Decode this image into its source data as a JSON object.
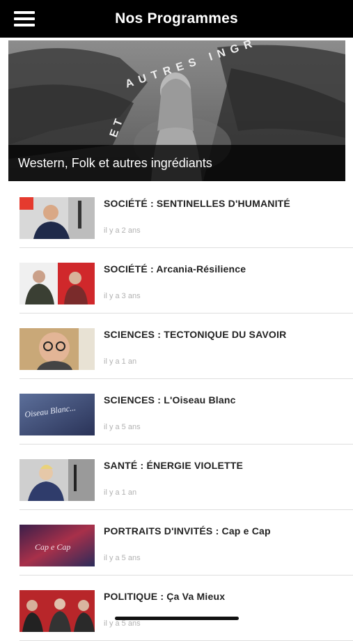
{
  "header": {
    "title": "Nos Programmes",
    "menu_icon": "hamburger-menu-icon"
  },
  "hero": {
    "caption": "Western, Folk et autres ingrédiants",
    "arc_text": "AUTRES INGR",
    "arc_text_left": "ET"
  },
  "programs": [
    {
      "title": "SOCIÉTÉ : SENTINELLES D'HUMANITÉ",
      "time": "il y a 2 ans"
    },
    {
      "title": "SOCIÉTÉ : Arcania-Résilience",
      "time": "il y a 3 ans"
    },
    {
      "title": "SCIENCES : TECTONIQUE DU SAVOIR",
      "time": "il y a 1 an"
    },
    {
      "title": "SCIENCES : L'Oiseau Blanc",
      "time": "il y a 5 ans",
      "thumb_text": "Oiseau Blanc..."
    },
    {
      "title": "SANTÉ : ÉNERGIE VIOLETTE",
      "time": "il y a 1 an"
    },
    {
      "title": "PORTRAITS D'INVITÉS : Cap e Cap",
      "time": "il y a 5 ans",
      "thumb_text": "Cap e Cap"
    },
    {
      "title": "POLITIQUE : Ça Va Mieux",
      "time": "il y a 5 ans"
    }
  ]
}
